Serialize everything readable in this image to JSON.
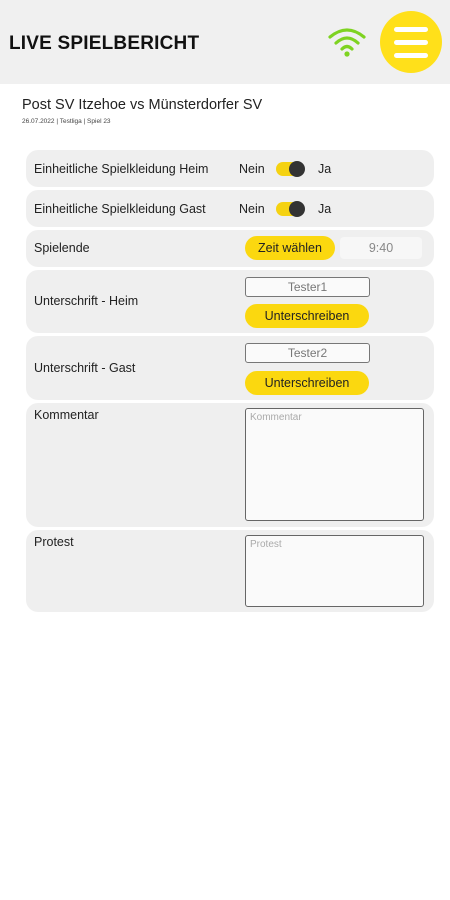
{
  "header": {
    "title": "LIVE SPIELBERICHT",
    "wifi_icon": "wifi-icon",
    "wifi_color": "#7ed321",
    "menu_icon": "hamburger-menu-icon",
    "accent_color": "#ffe01a"
  },
  "match": {
    "title": "Post SV Itzehoe vs Münsterdorfer SV",
    "meta": "26.07.2022 | Testliga | Spiel 23"
  },
  "rows": {
    "kit_home": {
      "label": "Einheitliche Spielkleidung Heim",
      "no": "Nein",
      "yes": "Ja",
      "value": true
    },
    "kit_away": {
      "label": "Einheitliche Spielkleidung Gast",
      "no": "Nein",
      "yes": "Ja",
      "value": true
    },
    "match_end": {
      "label": "Spielende",
      "button": "Zeit wählen",
      "time": "9:40"
    },
    "sign_home": {
      "label": "Unterschrift - Heim",
      "name": "Tester1",
      "button": "Unterschreiben"
    },
    "sign_away": {
      "label": "Unterschrift - Gast",
      "name": "Tester2",
      "button": "Unterschreiben"
    },
    "comment": {
      "label": "Kommentar",
      "placeholder": "Kommentar"
    },
    "protest": {
      "label": "Protest",
      "placeholder": "Protest"
    }
  }
}
